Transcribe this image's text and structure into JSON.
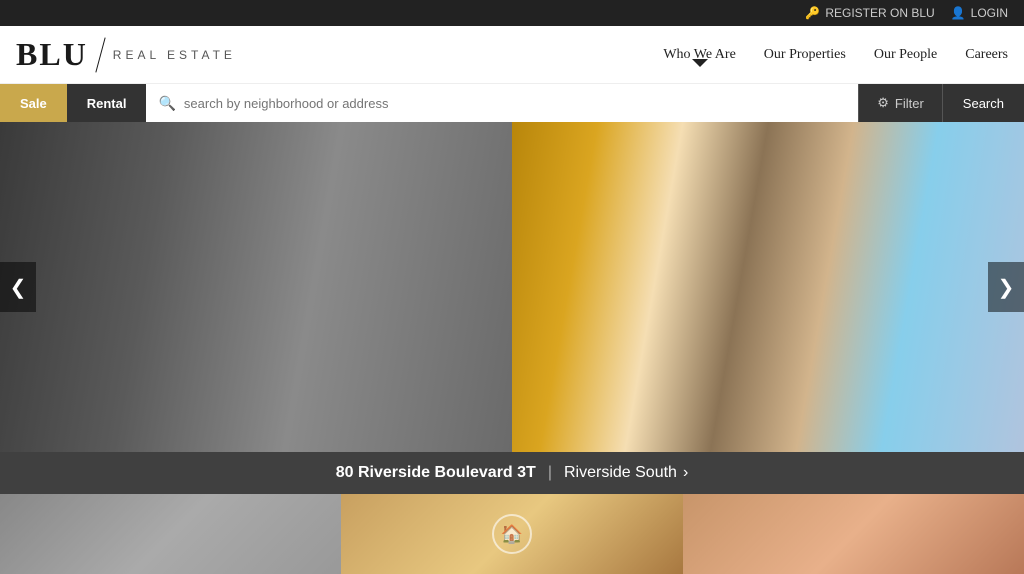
{
  "topbar": {
    "register_label": "REGISTER ON BLU",
    "login_label": "LOGIN",
    "key_icon": "🔑",
    "user_icon": "👤"
  },
  "header": {
    "logo_blu": "BLU",
    "logo_tagline": "REAL ESTATE",
    "nav": [
      {
        "id": "who-we-are",
        "label": "Who We Are",
        "active": true
      },
      {
        "id": "our-properties",
        "label": "Our Properties",
        "active": false
      },
      {
        "id": "our-people",
        "label": "Our People",
        "active": false
      },
      {
        "id": "careers",
        "label": "Careers",
        "active": false
      }
    ]
  },
  "searchbar": {
    "sale_tab": "Sale",
    "rental_tab": "Rental",
    "placeholder": "search by neighborhood or address",
    "filter_label": "Filter",
    "search_label": "Search",
    "filter_icon": "⚙"
  },
  "hero": {
    "prev_label": "❮",
    "next_label": "❯",
    "caption_bold": "80 Riverside Boulevard 3T",
    "caption_sep": "|",
    "caption_location": "Riverside South",
    "caption_arrow": "›"
  },
  "thumbnails": []
}
